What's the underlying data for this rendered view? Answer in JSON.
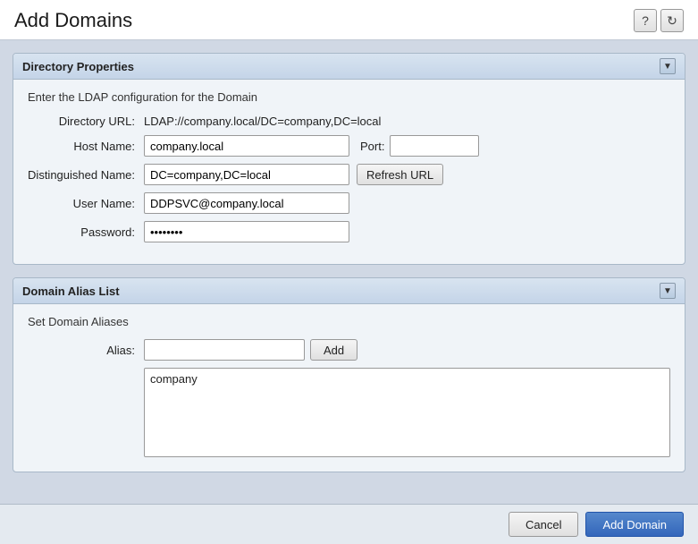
{
  "header": {
    "title": "Add Domains",
    "help_icon": "?",
    "refresh_icon": "↻"
  },
  "directory_properties": {
    "panel_title": "Directory Properties",
    "description": "Enter the LDAP configuration for the Domain",
    "fields": {
      "directory_url_label": "Directory URL:",
      "directory_url_value": "LDAP://company.local/DC=company,DC=local",
      "host_name_label": "Host Name:",
      "host_name_value": "company.local",
      "host_name_placeholder": "",
      "port_label": "Port:",
      "port_value": "",
      "port_placeholder": "",
      "distinguished_name_label": "Distinguished Name:",
      "distinguished_name_value": "DC=company,DC=local",
      "distinguished_name_placeholder": "",
      "refresh_url_label": "Refresh URL",
      "user_name_label": "User Name:",
      "user_name_value": "DDPSVC@company.local",
      "user_name_placeholder": "",
      "password_label": "Password:",
      "password_value": "••••••••",
      "password_placeholder": ""
    }
  },
  "domain_alias_list": {
    "panel_title": "Domain Alias List",
    "description": "Set Domain Aliases",
    "alias_label": "Alias:",
    "alias_placeholder": "",
    "add_button_label": "Add",
    "alias_items": [
      "company"
    ]
  },
  "footer": {
    "cancel_label": "Cancel",
    "add_domain_label": "Add Domain"
  }
}
